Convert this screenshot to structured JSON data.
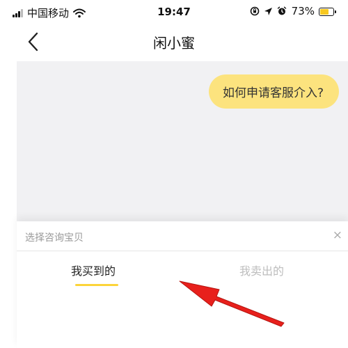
{
  "status_bar": {
    "carrier": "中国移动",
    "time": "19:47",
    "battery_percent": "73%",
    "battery_level": 0.73,
    "icons": [
      "signal-icon",
      "wifi-icon",
      "orientation-lock-icon",
      "location-icon",
      "alarm-icon",
      "battery-icon"
    ]
  },
  "nav": {
    "title": "闲小蜜",
    "back_icon": "chevron-left-icon"
  },
  "chat": {
    "bubble_text": "如何申请客服介入?"
  },
  "sheet": {
    "title": "选择咨询宝贝",
    "close_label": "×",
    "tabs": [
      {
        "label": "我买到的",
        "active": true
      },
      {
        "label": "我卖出的",
        "active": false
      }
    ]
  },
  "colors": {
    "accent_yellow": "#fcd43a",
    "bubble_yellow": "#fce37e",
    "chat_background": "#f1f1f3",
    "annotation_arrow": "#e8201c"
  },
  "annotation": {
    "type": "red-arrow-icon",
    "points_to": "tab-bought"
  }
}
